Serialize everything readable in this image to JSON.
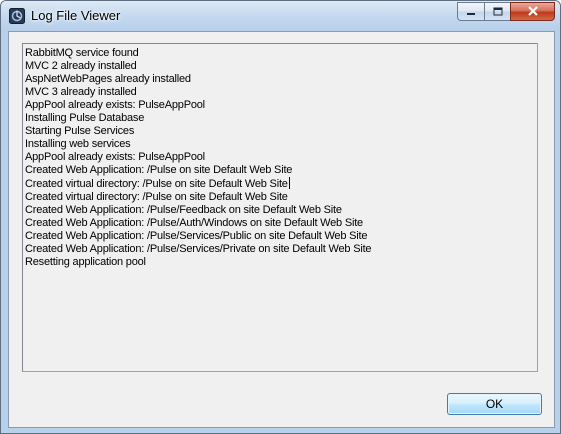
{
  "window": {
    "title": "Log File Viewer",
    "icon": "pulse-app-icon",
    "caption_buttons": {
      "minimize_icon": "minimize-icon",
      "maximize_icon": "maximize-icon",
      "close_icon": "close-icon"
    }
  },
  "log": {
    "lines": [
      "RabbitMQ service found",
      "MVC 2 already installed",
      "AspNetWebPages already installed",
      "MVC 3 already installed",
      "AppPool already exists: PulseAppPool",
      "Installing Pulse Database",
      "Starting Pulse Services",
      "Installing web services",
      "AppPool already exists: PulseAppPool",
      "Created Web Application: /Pulse on site Default Web Site",
      "Created virtual directory: /Pulse on site Default Web Site",
      "Created virtual directory: /Pulse on site Default Web Site",
      "Created Web Application: /Pulse/Feedback on site Default Web Site",
      "Created Web Application: /Pulse/Auth/Windows on site Default Web Site",
      "Created Web Application: /Pulse/Services/Public on site Default Web Site",
      "Created Web Application: /Pulse/Services/Private on site Default Web Site",
      "Resetting application pool"
    ]
  },
  "footer": {
    "ok_label": "OK"
  },
  "colors": {
    "client_background": "#f0f0f0",
    "titlebar": "#c6daf0",
    "close_button": "#c0391c",
    "ok_button_border": "#3c7fb1"
  }
}
